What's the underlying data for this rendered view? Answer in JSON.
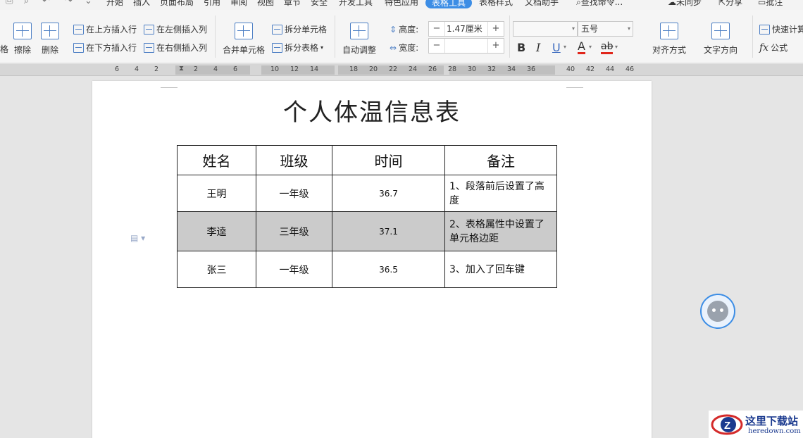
{
  "menubar": {
    "items": [
      "开始",
      "插入",
      "页面布局",
      "引用",
      "审阅",
      "视图",
      "章节",
      "安全",
      "开发工具",
      "特色应用",
      "表格工具",
      "表格样式",
      "文档助手"
    ],
    "active": "表格工具",
    "search": "查找命令...",
    "sync": "未同步",
    "share": "分享",
    "comment": "批注"
  },
  "ribbon": {
    "draw_table_partial": "格",
    "erase": "擦除",
    "delete": "删除",
    "insert_row_above": "在上方插入行",
    "insert_row_below": "在下方插入行",
    "insert_col_left": "在左侧插入列",
    "insert_col_right": "在右侧插入列",
    "merge_cells": "合并单元格",
    "split_cells": "拆分单元格",
    "split_table": "拆分表格",
    "auto_fit": "自动调整",
    "height_label": "高度:",
    "height_value": "1.47厘米",
    "width_label": "宽度:",
    "width_value": "",
    "font_name": "",
    "font_size": "五号",
    "bold": "B",
    "italic": "I",
    "underline": "U",
    "font_color": "A",
    "highlight": "ab",
    "align": "对齐方式",
    "text_direction": "文字方向",
    "quick_calc": "快速计算",
    "formula_icon": "fx",
    "formula": "公式"
  },
  "ruler": {
    "labels": [
      "6",
      "4",
      "2",
      "2",
      "4",
      "6",
      "10",
      "12",
      "14",
      "18",
      "20",
      "22",
      "24",
      "26",
      "28",
      "30",
      "32",
      "34",
      "36",
      "40",
      "42",
      "44",
      "46"
    ]
  },
  "document": {
    "title": "个人体温信息表",
    "table": {
      "headers": [
        "姓名",
        "班级",
        "时间",
        "备注"
      ],
      "rows": [
        [
          "王明",
          "一年级",
          "36.7",
          "1、段落前后设置了高度"
        ],
        [
          "李逵",
          "三年级",
          "37.1",
          "2、表格属性中设置了单元格边距"
        ],
        [
          "张三",
          "一年级",
          "36.5",
          "3、加入了回车键"
        ]
      ]
    }
  },
  "watermark": {
    "name": "这里下载站",
    "url": "heredown.com"
  },
  "colors": {
    "accent": "#3c8de5",
    "shaded_row": "#cbcbcb",
    "canvas": "#e5e5e5"
  }
}
